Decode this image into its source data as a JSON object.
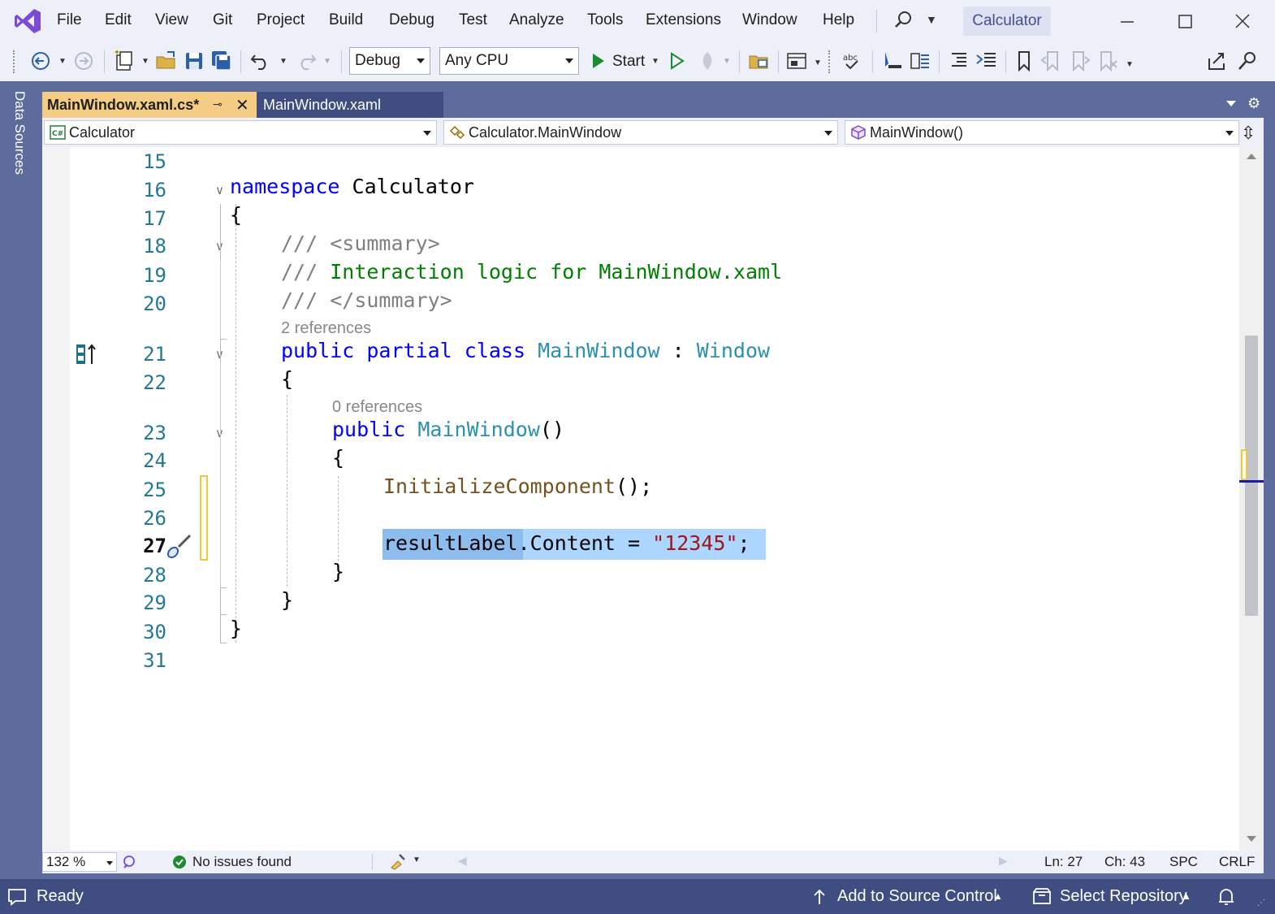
{
  "menu": {
    "items": [
      "File",
      "Edit",
      "View",
      "Git",
      "Project",
      "Build",
      "Debug",
      "Test",
      "Analyze",
      "Tools",
      "Extensions",
      "Window",
      "Help"
    ],
    "title": "Calculator"
  },
  "toolbar": {
    "configuration": "Debug",
    "platform": "Any CPU",
    "start_label": "Start"
  },
  "side_panel": {
    "label": "Data Sources"
  },
  "tabs": [
    {
      "label": "MainWindow.xaml.cs*",
      "active": true
    },
    {
      "label": "MainWindow.xaml",
      "active": false
    }
  ],
  "navbar": {
    "project": "Calculator",
    "type": "Calculator.MainWindow",
    "member": "MainWindow()"
  },
  "editor": {
    "line_numbers": [
      "15",
      "16",
      "17",
      "18",
      "19",
      "20",
      "21",
      "22",
      "23",
      "24",
      "25",
      "26",
      "27",
      "28",
      "29",
      "30",
      "31"
    ],
    "current_line": "27",
    "code": {
      "l16_kw": "namespace",
      "l16_name": " Calculator",
      "l17": "{",
      "l18_slashes": "/// ",
      "l18_tag": "<summary>",
      "l19_slashes": "/// ",
      "l19_text": "Interaction logic for MainWindow.xaml",
      "l20_slashes": "/// ",
      "l20_tag": "</summary>",
      "refs_class": "2 references",
      "l21_kw": "public partial class",
      "l21_type": "MainWindow",
      "l21_colon": " : ",
      "l21_base": "Window",
      "l22": "{",
      "refs_ctor": "0 references",
      "l23_kw": "public",
      "l23_type": "MainWindow",
      "l23_paren": "()",
      "l24": "{",
      "l25_method": "InitializeComponent",
      "l25_rest": "();",
      "l27_ident": "resultLabel",
      "l27_mid": ".Content = ",
      "l27_str": "\"12345\"",
      "l27_end": ";",
      "l28": "}",
      "l29": "}",
      "l30": "}"
    }
  },
  "editor_status": {
    "zoom": "132 %",
    "issues": "No issues found",
    "ln": "Ln: 27",
    "ch": "Ch: 43",
    "spc": "SPC",
    "eol": "CRLF"
  },
  "status": {
    "ready": "Ready",
    "source_control": "Add to Source Control",
    "repository": "Select Repository"
  },
  "colors": {
    "accent": "#3f4d80",
    "frame": "#5d6b9d",
    "active_tab": "#f5cc84",
    "keyword": "#0000ff",
    "type": "#2b91af",
    "comment": "#008000",
    "string": "#a31515"
  }
}
